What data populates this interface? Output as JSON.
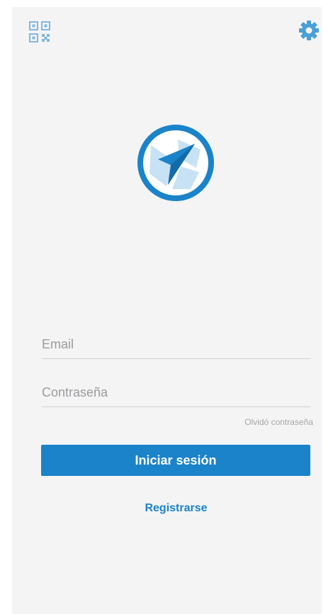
{
  "header": {
    "qr_icon": "qr-code-icon",
    "settings_icon": "gear-icon"
  },
  "logo": {
    "icon": "compass-arrow-logo",
    "primary_color": "#1a83c9",
    "secondary_color": "#c7e2f4"
  },
  "login_form": {
    "email_placeholder": "Email",
    "password_placeholder": "Contraseña",
    "forgot_password_label": "Olvidó contraseña",
    "submit_label": "Iniciar sesión",
    "register_label": "Registrarse"
  },
  "colors": {
    "accent": "#1a83c9",
    "background": "#f4f4f5",
    "muted_text": "#9a9a9e"
  }
}
